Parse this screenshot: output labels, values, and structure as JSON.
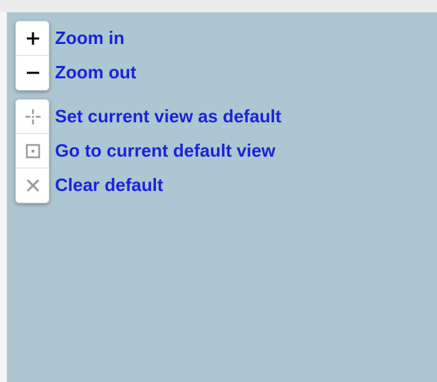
{
  "controls": {
    "zoom_in": {
      "label": "Zoom in"
    },
    "zoom_out": {
      "label": "Zoom out"
    },
    "set_default": {
      "label": "Set current view as default"
    },
    "goto_default": {
      "label": "Go to current default view"
    },
    "clear_default": {
      "label": "Clear default"
    }
  },
  "colors": {
    "map_background": "#acc7d2",
    "label_text": "#1a24d8"
  }
}
